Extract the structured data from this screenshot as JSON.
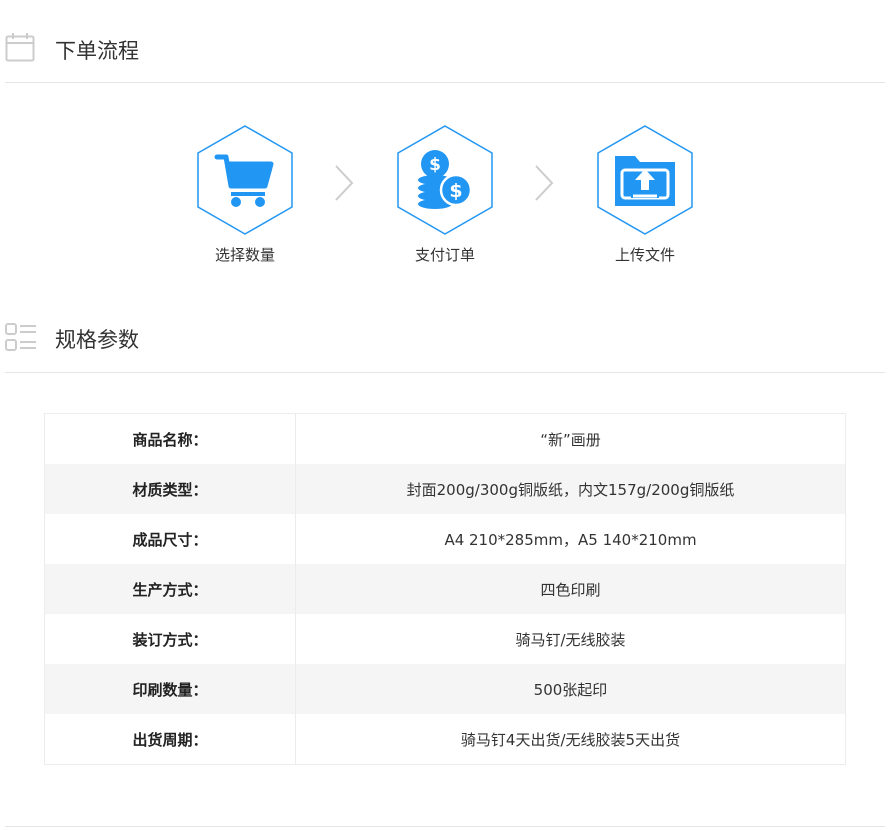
{
  "sections": {
    "order": {
      "title": "下单流程",
      "icon": "calendar-icon"
    },
    "specs": {
      "title": "规格参数",
      "icon": "list-icon"
    }
  },
  "steps": [
    {
      "label": "选择数量",
      "icon": "cart-icon"
    },
    {
      "label": "支付订单",
      "icon": "coins-dollar-icon"
    },
    {
      "label": "上传文件",
      "icon": "folder-upload-icon"
    }
  ],
  "specs": {
    "rows": [
      {
        "key": "商品名称：",
        "value": "“新”画册"
      },
      {
        "key": "材质类型：",
        "value": "封面200g/300g铜版纸，内文157g/200g铜版纸"
      },
      {
        "key": "成品尺寸：",
        "value": "A4 210*285mm，A5 140*210mm"
      },
      {
        "key": "生产方式：",
        "value": "四色印刷"
      },
      {
        "key": "装订方式：",
        "value": "骑马钉/无线胶装"
      },
      {
        "key": "印刷数量：",
        "value": "500张起印"
      },
      {
        "key": "出货周期：",
        "value": "骑马钉4天出货/无线胶装5天出货"
      }
    ]
  },
  "colors": {
    "accent": "#2196f3",
    "icon_gray": "#cccccc",
    "row_alt": "#f5f5f5",
    "divider": "#e5e5e5"
  }
}
